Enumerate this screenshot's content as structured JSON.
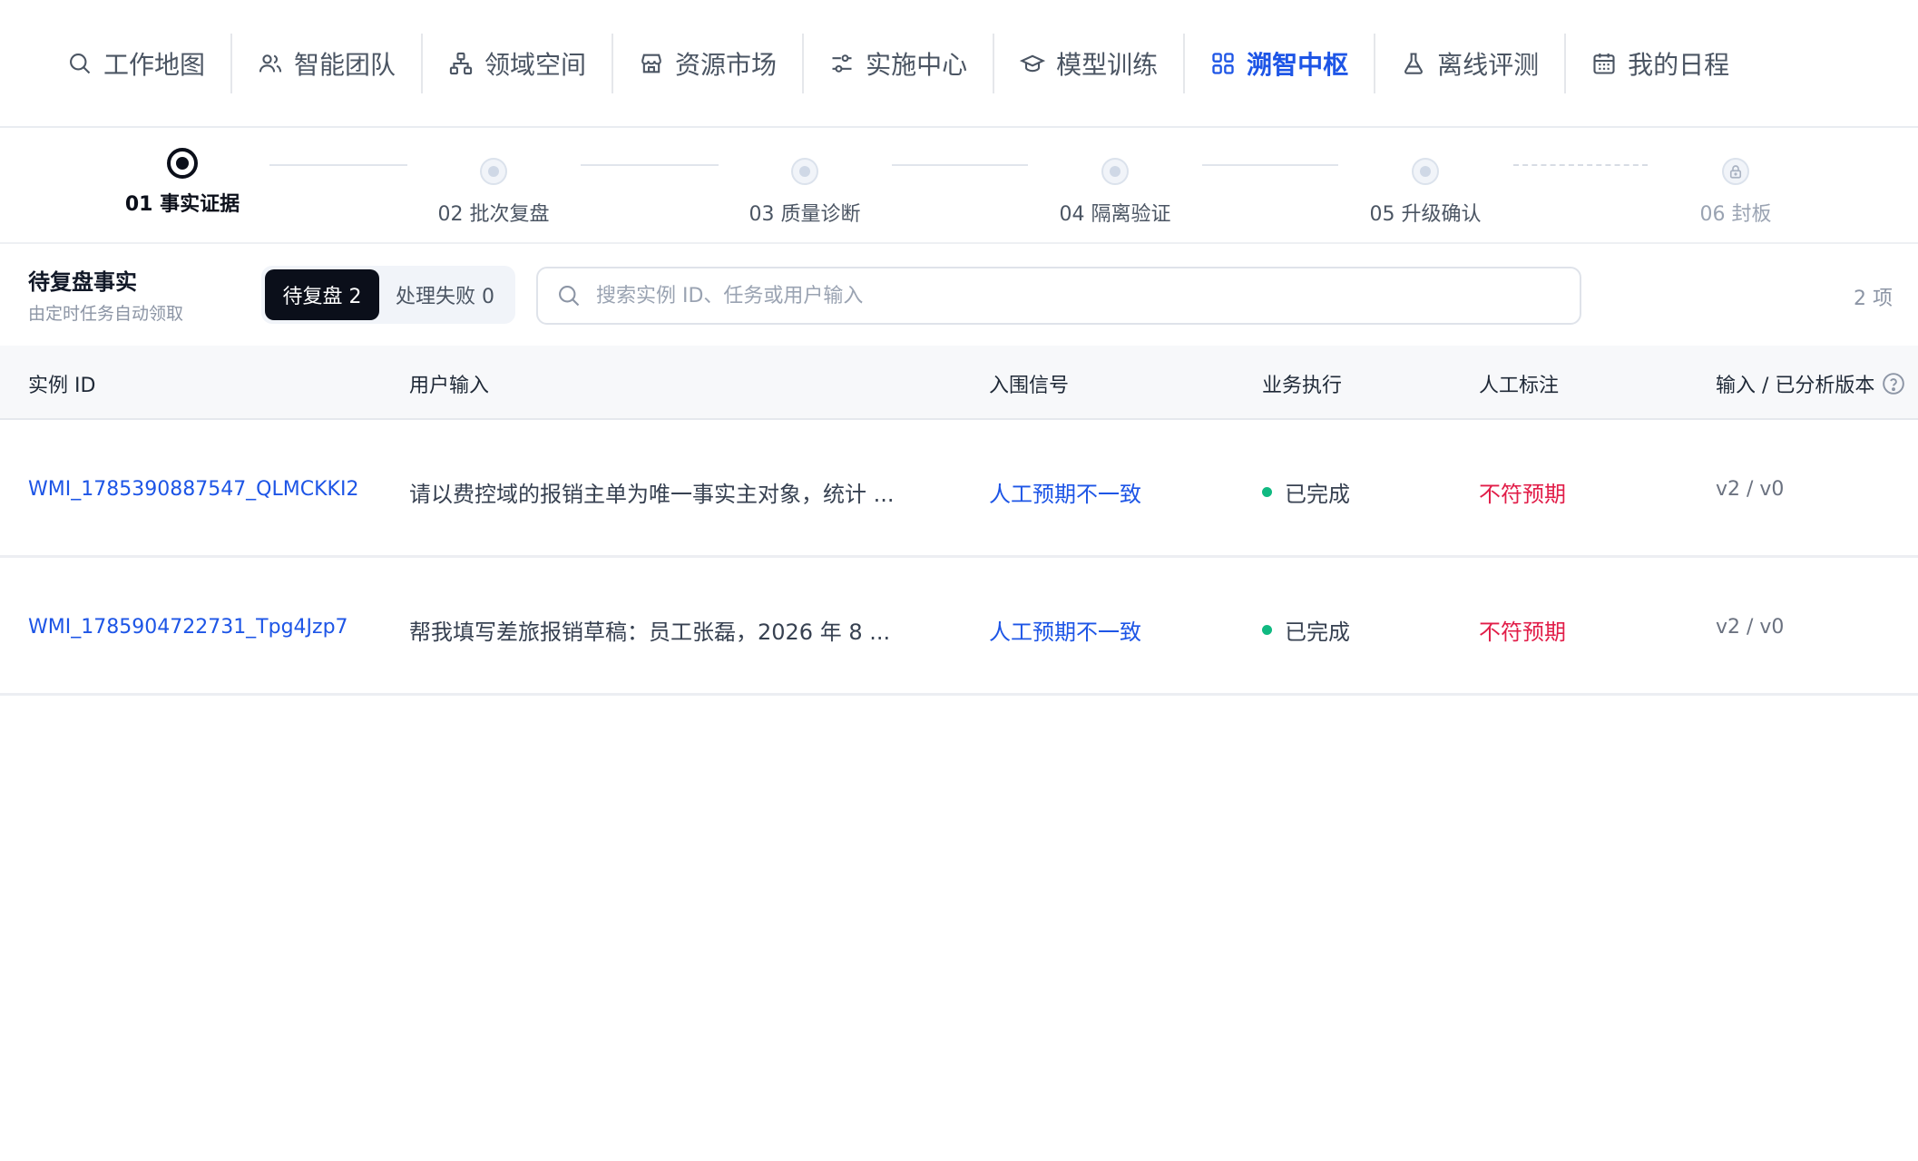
{
  "nav": {
    "items": [
      {
        "label": "工作地图",
        "icon": "search-icon",
        "active": false
      },
      {
        "label": "智能团队",
        "icon": "users-icon",
        "active": false
      },
      {
        "label": "领域空间",
        "icon": "hierarchy-icon",
        "active": false
      },
      {
        "label": "资源市场",
        "icon": "store-icon",
        "active": false
      },
      {
        "label": "实施中心",
        "icon": "sliders-icon",
        "active": false
      },
      {
        "label": "模型训练",
        "icon": "graduation-cap-icon",
        "active": false
      },
      {
        "label": "溯智中枢",
        "icon": "grid-icon",
        "active": true
      },
      {
        "label": "离线评测",
        "icon": "flask-icon",
        "active": false
      },
      {
        "label": "我的日程",
        "icon": "calendar-icon",
        "active": false
      }
    ]
  },
  "stepper": {
    "steps": [
      {
        "label": "01 事实证据",
        "state": "current"
      },
      {
        "label": "02 批次复盘",
        "state": "pending"
      },
      {
        "label": "03 质量诊断",
        "state": "pending"
      },
      {
        "label": "04 隔离验证",
        "state": "pending"
      },
      {
        "label": "05 升级确认",
        "state": "pending"
      },
      {
        "label": "06 封板",
        "state": "locked"
      }
    ]
  },
  "toolbar": {
    "title": "待复盘事实",
    "subtitle": "由定时任务自动领取",
    "tabs": [
      {
        "label": "待复盘 2",
        "active": true
      },
      {
        "label": "处理失败 0",
        "active": false
      }
    ],
    "search_placeholder": "搜索实例 ID、任务或用户输入",
    "count": "2 项"
  },
  "table": {
    "headers": [
      "实例 ID",
      "用户输入",
      "入围信号",
      "业务执行",
      "人工标注",
      "输入 / 已分析版本"
    ],
    "rows": [
      {
        "id": "WMI_1785390887547_QLMCKKI2",
        "input": "请以费控域的报销主单为唯一事实主对象，统计 ...",
        "signal": "人工预期不一致",
        "execution": "已完成",
        "annotation": "不符预期",
        "version": "v2 / v0"
      },
      {
        "id": "WMI_1785904722731_Tpg4Jzp7",
        "input": "帮我填写差旅报销草稿：员工张磊，2026 年 8 ...",
        "signal": "人工预期不一致",
        "execution": "已完成",
        "annotation": "不符预期",
        "version": "v2 / v0"
      }
    ]
  },
  "colors": {
    "accent": "#1d55e6",
    "negative": "#e11d48",
    "success": "#10b981",
    "dark": "#0b0f1a"
  }
}
